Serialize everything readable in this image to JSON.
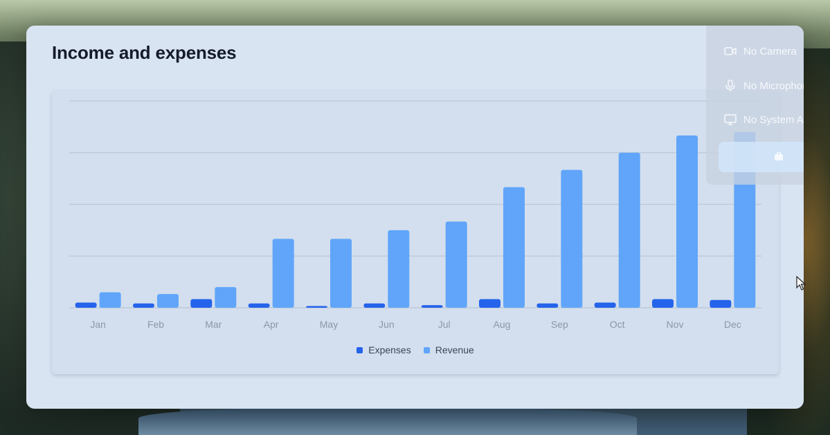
{
  "window": {
    "title": "Income and expenses"
  },
  "chart_data": {
    "type": "bar",
    "categories": [
      "Jan",
      "Feb",
      "Mar",
      "Apr",
      "May",
      "Jun",
      "Jul",
      "Aug",
      "Sep",
      "Oct",
      "Nov",
      "Dec"
    ],
    "series": [
      {
        "name": "Expenses",
        "values": [
          3,
          2.5,
          5,
          2.5,
          1,
          2.5,
          1.5,
          5,
          2.5,
          3,
          5,
          4.5
        ]
      },
      {
        "name": "Revenue",
        "values": [
          9,
          8,
          12,
          40,
          40,
          45,
          50,
          70,
          80,
          90,
          100,
          102
        ]
      }
    ],
    "ylim": [
      0,
      120
    ],
    "ygrid": [
      0,
      30,
      60,
      90,
      120
    ],
    "grid": true,
    "legend_position": "bottom-center",
    "title": "",
    "xlabel": "",
    "ylabel": ""
  },
  "colors": {
    "expenses": "#2563eb",
    "revenue": "#60a5fa"
  },
  "legend": {
    "expenses": "Expenses",
    "revenue": "Revenue"
  },
  "overlay": {
    "camera_label": "No Camera",
    "microphone_label": "No Microphone",
    "system_audio_label": "No System Audio",
    "camera_icon": "camera-icon",
    "microphone_icon": "microphone-icon",
    "system_audio_icon": "monitor-icon"
  }
}
